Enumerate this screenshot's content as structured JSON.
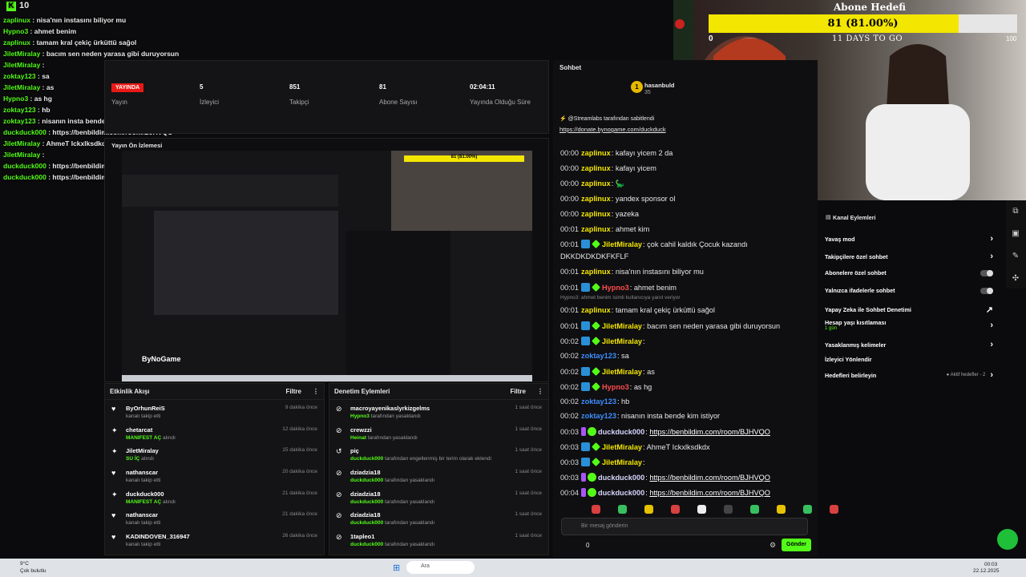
{
  "overlay": {
    "kick_count": "10",
    "lines": [
      {
        "user": "zaplinux",
        "text": " : nisa'nın instasını biliyor mu"
      },
      {
        "user": "Hypno3",
        "text": " : ahmet benim"
      },
      {
        "user": "zaplinux",
        "text": " : tamam kral çekiç ürküttü sağol"
      },
      {
        "user": "JiletMiralay",
        "text": " : bacım sen neden yarasa gibi duruyorsun"
      },
      {
        "user": "JiletMiralay",
        "text": " :"
      },
      {
        "user": "zoktay123",
        "text": " : sa"
      },
      {
        "user": "JiletMiralay",
        "text": " : as"
      },
      {
        "user": "Hypno3",
        "text": " : as hg"
      },
      {
        "user": "zoktay123",
        "text": " : hb"
      },
      {
        "user": "zoktay123",
        "text": " : nisanın insta bende kim istiyor"
      },
      {
        "user": "duckduck000",
        "text": " : https://benbildim.com/room/BJHVQO"
      },
      {
        "user": "JiletMiralay",
        "text": " : AhmeT Ickxlksdkdx"
      },
      {
        "user": "JiletMiralay",
        "text": " :"
      },
      {
        "user": "duckduck000",
        "text": " : https://benbildim.com/room/BJHVQO"
      },
      {
        "user": "duckduck000",
        "text": " : https://benbildim.com/room/BJHVQO"
      }
    ]
  },
  "dashboard": {
    "live_label": "YAYINDA",
    "stats": [
      {
        "value": "5",
        "label": "İzleyici"
      },
      {
        "value": "851",
        "label": "Takipçi"
      },
      {
        "value": "81",
        "label": "Abone Sayısı"
      },
      {
        "value": "02:04:11",
        "label": "Yayında Olduğu Süre"
      }
    ],
    "stream_label": "Yayın",
    "preview_label": "Yayın Ön İzlemesi",
    "watermark": "ByNoGame"
  },
  "activity": {
    "title": "Etkinlik Akışı",
    "filter": "Filtre",
    "items": [
      {
        "icon": "♥",
        "name": "ByOrhunReiS",
        "sub": "kanalı takip etti",
        "sub_hl": "",
        "time": "9 dakika önce"
      },
      {
        "icon": "✦",
        "name": "chetarcat",
        "sub": " alındı",
        "sub_hl": "MANIFEST AÇ",
        "time": "12 dakika önce"
      },
      {
        "icon": "✦",
        "name": "JiletMiralay",
        "sub": " alındı",
        "sub_hl": "SU İÇ",
        "time": "15 dakika önce"
      },
      {
        "icon": "♥",
        "name": "nathanscar",
        "sub": "kanalı takip etti",
        "sub_hl": "",
        "time": "20 dakika önce"
      },
      {
        "icon": "✦",
        "name": "duckduck000",
        "sub": " alındı",
        "sub_hl": "MANIFEST AÇ",
        "time": "21 dakika önce"
      },
      {
        "icon": "♥",
        "name": "nathanscar",
        "sub": "kanalı takip etti",
        "sub_hl": "",
        "time": "21 dakika önce"
      },
      {
        "icon": "♥",
        "name": "KADINDOVEN_316947",
        "sub": "kanalı takip etti",
        "sub_hl": "",
        "time": "26 dakika önce"
      }
    ]
  },
  "moderation": {
    "title": "Denetim Eylemleri",
    "filter": "Filtre",
    "items": [
      {
        "icon": "⊘",
        "name": "macroyayenikaslyrkizgelms",
        "sub_hl": "Hypno3",
        "sub": " tarafından yasaklandı",
        "time": "1 saat önce"
      },
      {
        "icon": "⊘",
        "name": "crewzzi",
        "sub_hl": "Heinat",
        "sub": " tarafından yasaklandı",
        "time": "1 saat önce"
      },
      {
        "icon": "↺",
        "name": "piç",
        "sub_hl": "duckduck000",
        "sub": " tarafından engellenmiş bir terim olarak eklendi",
        "time": "1 saat önce"
      },
      {
        "icon": "⊘",
        "name": "dziadzia18",
        "sub_hl": "duckduck000",
        "sub": " tarafından yasaklandı",
        "time": "1 saat önce"
      },
      {
        "icon": "⊘",
        "name": "dziadzia18",
        "sub_hl": "duckduck000",
        "sub": " tarafından yasaklandı",
        "time": "1 saat önce"
      },
      {
        "icon": "⊘",
        "name": "dziadzia18",
        "sub_hl": "duckduck000",
        "sub": " tarafından yasaklandı",
        "time": "1 saat önce"
      },
      {
        "icon": "⊘",
        "name": "1tapleo1",
        "sub_hl": "duckduck000",
        "sub": " tarafından yasaklandı",
        "time": "1 saat önce"
      }
    ]
  },
  "chat": {
    "title": "Sohbet",
    "pinned_by": "@Streamlabs tarafından sabitlendi",
    "pinned_link": "https://donate.bynogame.com/duckduck",
    "top_user": "hasanbuld",
    "top_count": "35",
    "lines": [
      {
        "ts": "00:00",
        "user": "zaplinux",
        "color": "#f3e600",
        "text": "kafayı yicem 2 da",
        "link": ""
      },
      {
        "ts": "00:00",
        "user": "zaplinux",
        "color": "#f3e600",
        "text": "kafayı yicem",
        "link": ""
      },
      {
        "ts": "00:00",
        "user": "zaplinux",
        "color": "#f3e600",
        "text": "🦕",
        "link": ""
      },
      {
        "ts": "00:00",
        "user": "zaplinux",
        "color": "#f3e600",
        "text": "yandex sponsor ol",
        "link": ""
      },
      {
        "ts": "00:00",
        "user": "zaplinux",
        "color": "#f3e600",
        "text": "yazeka",
        "link": ""
      },
      {
        "ts": "00:01",
        "user": "zaplinux",
        "color": "#f3e600",
        "text": "ahmet kim",
        "link": ""
      },
      {
        "ts": "00:01",
        "user": "JiletMiralay",
        "color": "#f3e600",
        "text": "çok cahil kaldık Çocuk kazandı",
        "link": ""
      },
      {
        "ts": "",
        "user": "",
        "color": "#fff",
        "text": "DKKDKDKDKFKFLF",
        "link": ""
      },
      {
        "ts": "00:01",
        "user": "zaplinux",
        "color": "#f3e600",
        "text": "nisa'nın instasını biliyor mu",
        "link": ""
      },
      {
        "ts": "00:01",
        "user": "Hypno3",
        "color": "#ff4b4b",
        "text": "ahmet benim",
        "link": ""
      },
      {
        "ts": "00:01",
        "user": "zaplinux",
        "color": "#f3e600",
        "text": "tamam kral çekiç ürküttü sağol",
        "link": ""
      },
      {
        "ts": "00:01",
        "user": "JiletMiralay",
        "color": "#f3e600",
        "text": "bacım sen neden yarasa gibi duruyorsun",
        "link": ""
      },
      {
        "ts": "00:02",
        "user": "JiletMiralay",
        "color": "#f3e600",
        "text": "",
        "link": ""
      },
      {
        "ts": "00:02",
        "user": "zoktay123",
        "color": "#3d8eff",
        "text": "sa",
        "link": ""
      },
      {
        "ts": "00:02",
        "user": "JiletMiralay",
        "color": "#f3e600",
        "text": "as",
        "link": ""
      },
      {
        "ts": "00:02",
        "user": "Hypno3",
        "color": "#ff4b4b",
        "text": "as hg",
        "link": ""
      },
      {
        "ts": "00:02",
        "user": "zoktay123",
        "color": "#3d8eff",
        "text": "hb",
        "link": ""
      },
      {
        "ts": "00:02",
        "user": "zoktay123",
        "color": "#3d8eff",
        "text": "nisanın insta bende kim istiyor",
        "link": ""
      },
      {
        "ts": "00:03",
        "user": "duckduck000",
        "color": "#d6d6ff",
        "text": "",
        "link": "https://benbildim.com/room/BJHVQO"
      },
      {
        "ts": "00:03",
        "user": "JiletMiralay",
        "color": "#f3e600",
        "text": "AhmeT Ickxlksdkdx",
        "link": ""
      },
      {
        "ts": "00:03",
        "user": "JiletMiralay",
        "color": "#f3e600",
        "text": "",
        "link": ""
      },
      {
        "ts": "00:03",
        "user": "duckduck000",
        "color": "#d6d6ff",
        "text": "",
        "link": "https://benbildim.com/room/BJHVQO"
      },
      {
        "ts": "00:04",
        "user": "duckduck000",
        "color": "#d6d6ff",
        "text": "",
        "link": "https://benbildim.com/room/BJHVQO"
      }
    ],
    "deleted_note": "Hypno3: ahmet benim isimli kullanıcıya yanıt veriyor",
    "input_placeholder": "Bir mesaj gönderin",
    "send_label": "Gönder",
    "counter": "0"
  },
  "goal": {
    "title": "Abone Hedefi",
    "text": "81 (81.00%)",
    "progress": 0.81,
    "days": "11 DAYS TO GO",
    "min": "0",
    "max": "100"
  },
  "actions": {
    "title": "Kanal Eylemleri",
    "items": [
      {
        "label": "Yavaş mod",
        "right": "›",
        "sub": ""
      },
      {
        "label": "Takipçilere özel sohbet",
        "right": "›",
        "sub": ""
      },
      {
        "label": "Abonelere özel sohbet",
        "right": "toggle",
        "sub": ""
      },
      {
        "label": "Yalnızca ifadelerle sohbet",
        "right": "toggle",
        "sub": ""
      },
      {
        "label": "Yapay Zeka ile Sohbet Denetimi",
        "right": "↗",
        "sub": ""
      },
      {
        "label": "Hesap yaşı kısıtlaması",
        "right": "›",
        "sub": "1 gün"
      },
      {
        "label": "Yasaklanmış kelimeler",
        "right": "›",
        "sub": ""
      },
      {
        "label": "İzleyici Yönlendir",
        "right": "",
        "sub": ""
      },
      {
        "label": "Hedefleri belirleyin",
        "right": "›",
        "sub": "● Aktif hedefler - 2"
      }
    ]
  },
  "taskbar": {
    "weather": "9°C",
    "weather_sub": "Çok bulutlu",
    "search": "Ara",
    "time": "00:03",
    "date": "22.12.2025",
    "colors": {
      "kick_green": "#53fc18",
      "live_red": "#e91916",
      "goal_yellow": "#f3e600"
    }
  }
}
